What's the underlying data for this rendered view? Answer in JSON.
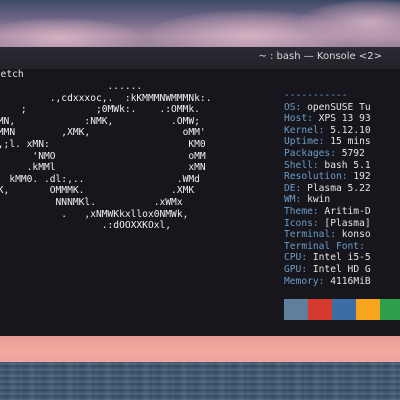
{
  "window": {
    "title": "~ : bash — Konsole <2>"
  },
  "terminal": {
    "command_fragment": "ofetch",
    "ascii_logo": [
      "                    ......",
      "          .,cdxxxoc,.  :kKMMMNWMMMNk:.",
      "     ;            ;0MWk:.    .:OMMk.",
      "MMN,            :NMK,          .OMW;",
      "MMMN        ,XMK,                oMM'",
      ",,;l. xMN:                        KM0",
      "       'NMO                       oMM",
      "      .kMMl                       xMN",
      "   kMM0. .dl:,..                .WMd",
      "MK,       OMMMK.               .XMK",
      "           NNNMKl.          .xWMx",
      "            .   ,xNMWKkxllox0NMWk,",
      "                   .:dOOXXKOxl,"
    ],
    "separator": "-----------",
    "info": [
      {
        "key": "OS",
        "value": " openSUSE Tu"
      },
      {
        "key": "Host",
        "value": " XPS 13 93"
      },
      {
        "key": "Kernel",
        "value": " 5.12.10"
      },
      {
        "key": "Uptime",
        "value": " 15 mins"
      },
      {
        "key": "Packages",
        "value": " 5792"
      },
      {
        "key": "Shell",
        "value": " bash 5.1"
      },
      {
        "key": "Resolution",
        "value": " 192"
      },
      {
        "key": "DE",
        "value": " Plasma 5.22"
      },
      {
        "key": "WM",
        "value": " kwin"
      },
      {
        "key": "Theme",
        "value": " Aritim-D"
      },
      {
        "key": "Icons",
        "value": " [Plasma]"
      },
      {
        "key": "Terminal",
        "value": " konso"
      },
      {
        "key": "Terminal Font",
        "value": ""
      },
      {
        "key": "CPU",
        "value": " Intel i5-5"
      },
      {
        "key": "GPU",
        "value": " Intel HD G"
      },
      {
        "key": "Memory",
        "value": " 4116MiB"
      }
    ],
    "palette_colors": [
      "#5f7f9e",
      "#d63a2e",
      "#3c6ea6",
      "#f6a51c",
      "#2f9e4d"
    ]
  },
  "colors": {
    "info_key": "#6d9cc8",
    "terminal_bg": "#16161c",
    "text": "#e6e6e6"
  }
}
